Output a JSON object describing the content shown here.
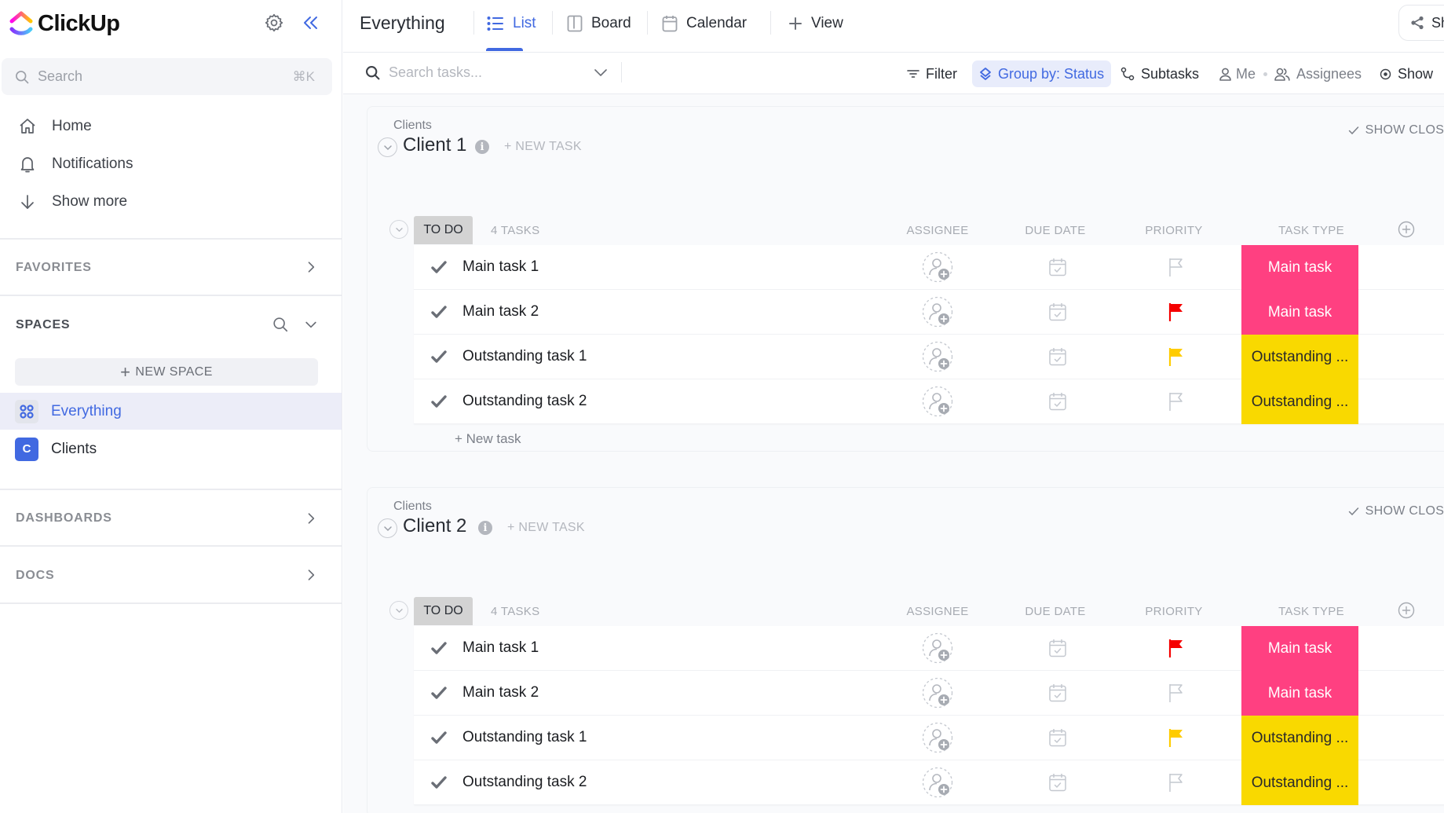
{
  "sidebar": {
    "brand": "ClickUp",
    "search": {
      "placeholder": "Search",
      "shortcut": "⌘K"
    },
    "nav": [
      {
        "label": "Home",
        "icon": "home-icon"
      },
      {
        "label": "Notifications",
        "icon": "bell-icon"
      },
      {
        "label": "Show more",
        "icon": "arrow-down-icon"
      }
    ],
    "sections": {
      "favorites": "FAVORITES",
      "spaces": "SPACES",
      "dashboards": "DASHBOARDS",
      "docs": "DOCS"
    },
    "new_space_label": "NEW SPACE",
    "spaces": [
      {
        "label": "Everything",
        "active": true
      },
      {
        "label": "Clients",
        "avatar": "C",
        "color": "#4169e1"
      }
    ]
  },
  "header": {
    "title": "Everything",
    "tabs": [
      {
        "label": "List",
        "active": true
      },
      {
        "label": "Board"
      },
      {
        "label": "Calendar"
      },
      {
        "label": "View"
      }
    ],
    "share_label": "Sh"
  },
  "toolbar": {
    "search_placeholder": "Search tasks...",
    "filter": "Filter",
    "group_by": "Group by: Status",
    "subtasks": "Subtasks",
    "me": "Me",
    "assignees": "Assignees",
    "show": "Show"
  },
  "columns": [
    "ASSIGNEE",
    "DUE DATE",
    "PRIORITY",
    "TASK TYPE"
  ],
  "colors": {
    "accent": "#4169e1",
    "main_task": "#ff4081",
    "outstanding": "#f9d900",
    "flag_urgent": "#f50000",
    "flag_high": "#ffcc00",
    "flag_none": "#c4c8cf"
  },
  "groups": [
    {
      "breadcrumb": "Clients",
      "title": "Client 1",
      "new_task_label": "+ NEW TASK",
      "show_closed": "SHOW CLOSED",
      "status": "TO DO",
      "count": "4 TASKS",
      "new_task_row": "+ New task",
      "tasks": [
        {
          "name": "Main task 1",
          "priority": "none",
          "type": "Main task",
          "type_style": "pink"
        },
        {
          "name": "Main task 2",
          "priority": "urgent",
          "type": "Main task",
          "type_style": "pink"
        },
        {
          "name": "Outstanding task 1",
          "priority": "high",
          "type": "Outstanding ...",
          "type_style": "yellow"
        },
        {
          "name": "Outstanding task 2",
          "priority": "none",
          "type": "Outstanding ...",
          "type_style": "yellow"
        }
      ]
    },
    {
      "breadcrumb": "Clients",
      "title": "Client 2",
      "new_task_label": "+ NEW TASK",
      "show_closed": "SHOW CLOSED",
      "status": "TO DO",
      "count": "4 TASKS",
      "tasks": [
        {
          "name": "Main task 1",
          "priority": "urgent",
          "type": "Main task",
          "type_style": "pink"
        },
        {
          "name": "Main task 2",
          "priority": "none",
          "type": "Main task",
          "type_style": "pink"
        },
        {
          "name": "Outstanding task 1",
          "priority": "high",
          "type": "Outstanding ...",
          "type_style": "yellow"
        },
        {
          "name": "Outstanding task 2",
          "priority": "none",
          "type": "Outstanding ...",
          "type_style": "yellow"
        }
      ]
    }
  ]
}
